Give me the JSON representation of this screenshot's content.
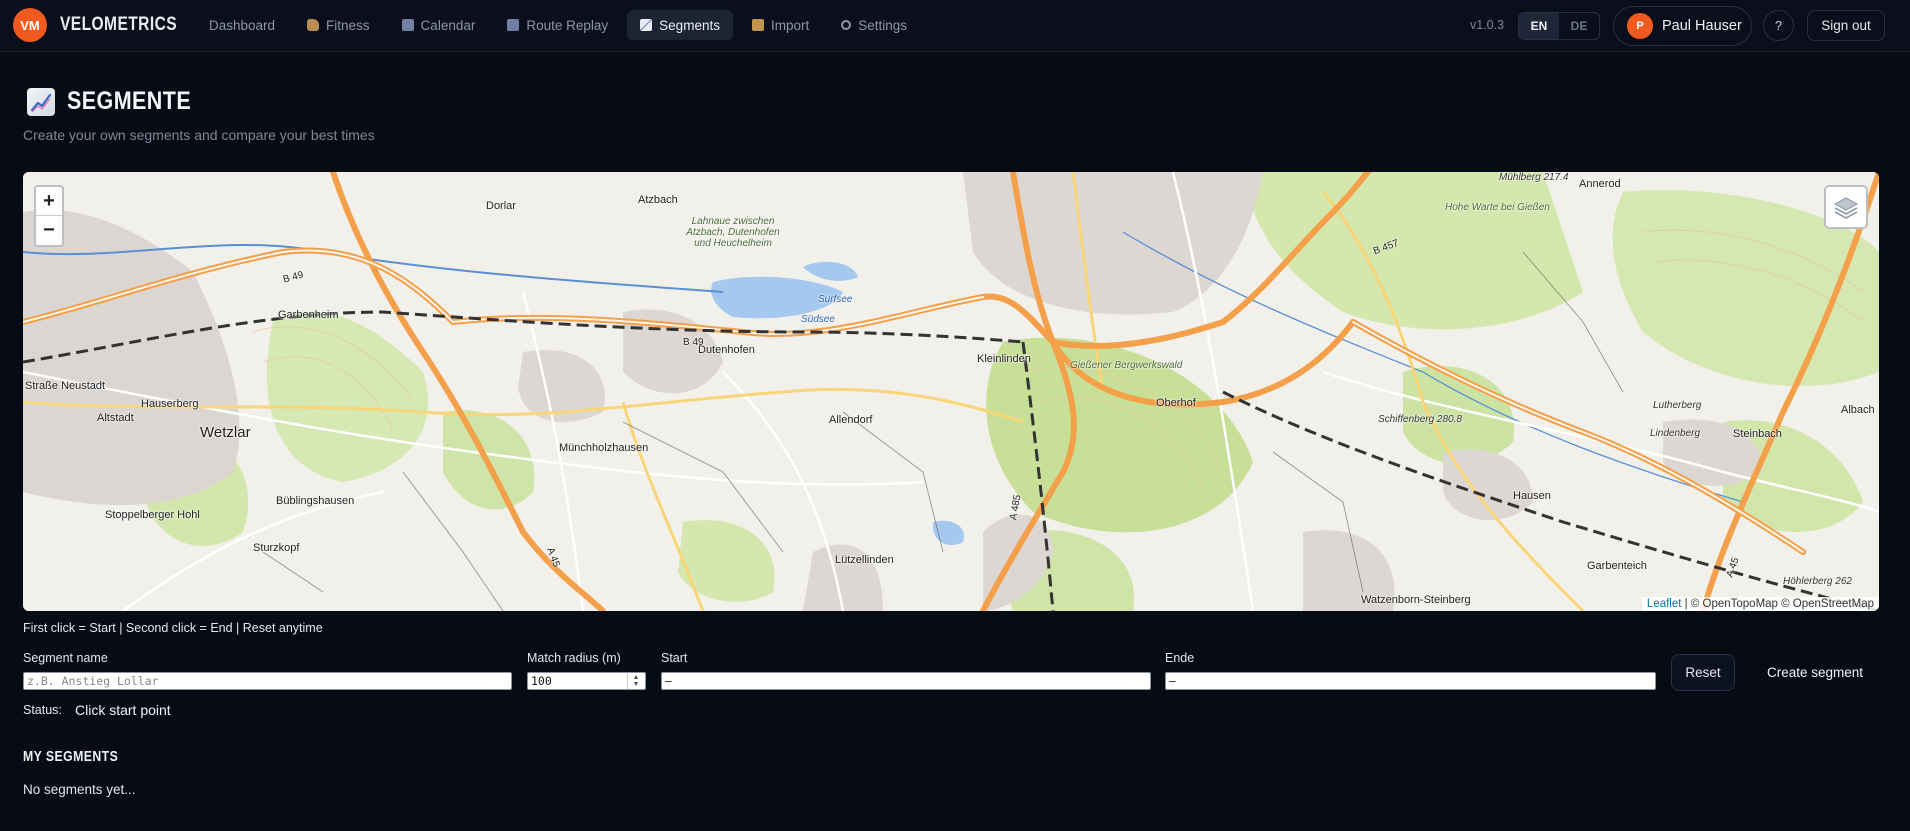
{
  "app": {
    "logo": "VM",
    "brand": "VELOMETRICS"
  },
  "nav": [
    {
      "label": "Dashboard",
      "icon": "none"
    },
    {
      "label": "Fitness",
      "icon": "flexed-arm-icon"
    },
    {
      "label": "Calendar",
      "icon": "calendar-icon"
    },
    {
      "label": "Route Replay",
      "icon": "route-icon"
    },
    {
      "label": "Segments",
      "icon": "chart-icon",
      "active": true
    },
    {
      "label": "Import",
      "icon": "folder-icon"
    },
    {
      "label": "Settings",
      "icon": "gear-icon"
    }
  ],
  "header": {
    "version": "v1.0.3",
    "lang": [
      "EN",
      "DE"
    ],
    "active_lang": "EN",
    "user": {
      "initial": "P",
      "name": "Paul Hauser"
    },
    "help": "?",
    "signout": "Sign out"
  },
  "page": {
    "title": "SEGMENTE",
    "subtitle": "Create your own segments and compare your best times"
  },
  "map": {
    "zoom_in": "+",
    "zoom_out": "−",
    "attribution": {
      "leaflet": "Leaflet",
      "rest": " | © OpenTopoMap © OpenStreetMap"
    },
    "labels": {
      "wetzlar": "Wetzlar",
      "garbenheim": "Garbenheim",
      "hauserberg": "Hauserberg",
      "altstadt": "Altstadt",
      "neustadt": "Straße Neustadt",
      "dorlar": "Dorlar",
      "atzbach": "Atzbach",
      "lahnaue": "Lahnaue zwischen Atzbach, Dutenhofen und Heuchelheim",
      "dutenhofen": "Dutenhofen",
      "surfsee": "Surfsee",
      "sudsee": "Südsee",
      "muenchholz": "Münchholzhausen",
      "allendorf": "Allendorf",
      "kleinlinden": "Kleinlinden",
      "berg": "Gießener Bergwerkswald",
      "oberhof": "Oberhof",
      "buelings": "Büblingshausen",
      "stoppel": "Stoppelberger Hohl",
      "sturz": "Sturzkopf",
      "luetzel": "Lützellinden",
      "annerod": "Annerod",
      "muehlberg": "Mühlberg 217.4",
      "hohe": "Hohe Warte bei Gießen",
      "schiffen": "Schiffenberg 280.8",
      "hausen": "Hausen",
      "garben2": "Garbenteich",
      "watzen": "Watzenborn-Steinberg",
      "luther": "Lutherberg",
      "linden": "Lindenberg",
      "steinbach": "Steinbach",
      "albach": "Albach",
      "hoehler": "Höhlerberg 262",
      "b457": "B 457",
      "a45": "A 45",
      "a45b": "A 45",
      "a485": "A 485",
      "b49": "B 49",
      "b49b": "B 49"
    }
  },
  "form": {
    "hint": "First click = Start | Second click = End | Reset anytime",
    "name_label": "Segment name",
    "name_placeholder": "z.B. Anstieg Lollar",
    "radius_label": "Match radius (m)",
    "radius_value": "100",
    "start_label": "Start",
    "start_value": "—",
    "end_label": "Ende",
    "end_value": "—",
    "reset": "Reset",
    "create": "Create segment",
    "status_label": "Status:",
    "status_value": "Click start point"
  },
  "segments": {
    "heading": "MY SEGMENTS",
    "empty": "No segments yet..."
  }
}
